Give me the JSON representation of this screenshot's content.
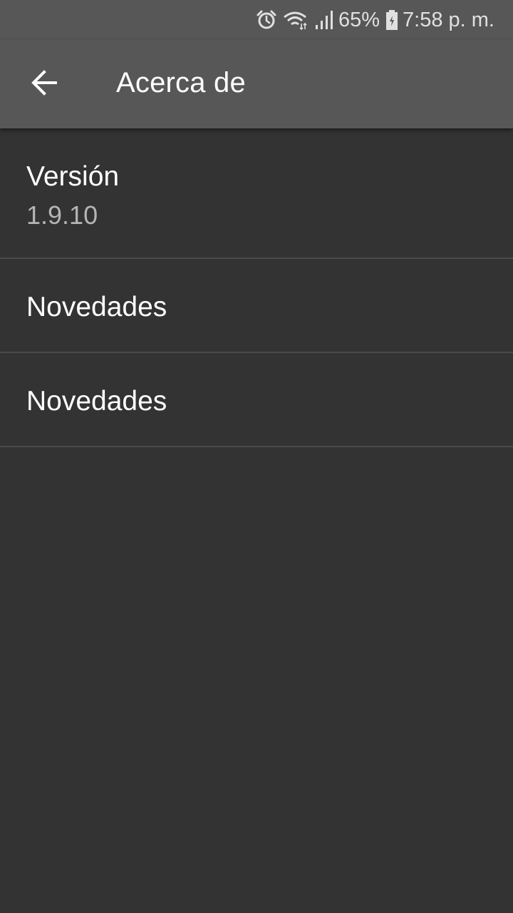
{
  "status_bar": {
    "battery_percent": "65%",
    "time": "7:58 p. m.",
    "icons": [
      "alarm-icon",
      "wifi-icon",
      "signal-icon",
      "battery-icon"
    ]
  },
  "app_bar": {
    "title": "Acerca de",
    "back_icon": "arrow-back-icon"
  },
  "list": {
    "items": [
      {
        "title": "Versión",
        "subtitle": "1.9.10"
      },
      {
        "title": "Novedades"
      },
      {
        "title": "Novedades"
      }
    ]
  },
  "colors": {
    "background": "#333333",
    "app_bar": "#575757",
    "divider": "#4a4a4a",
    "text_primary": "#ffffff",
    "text_secondary": "#b5b5b5"
  }
}
